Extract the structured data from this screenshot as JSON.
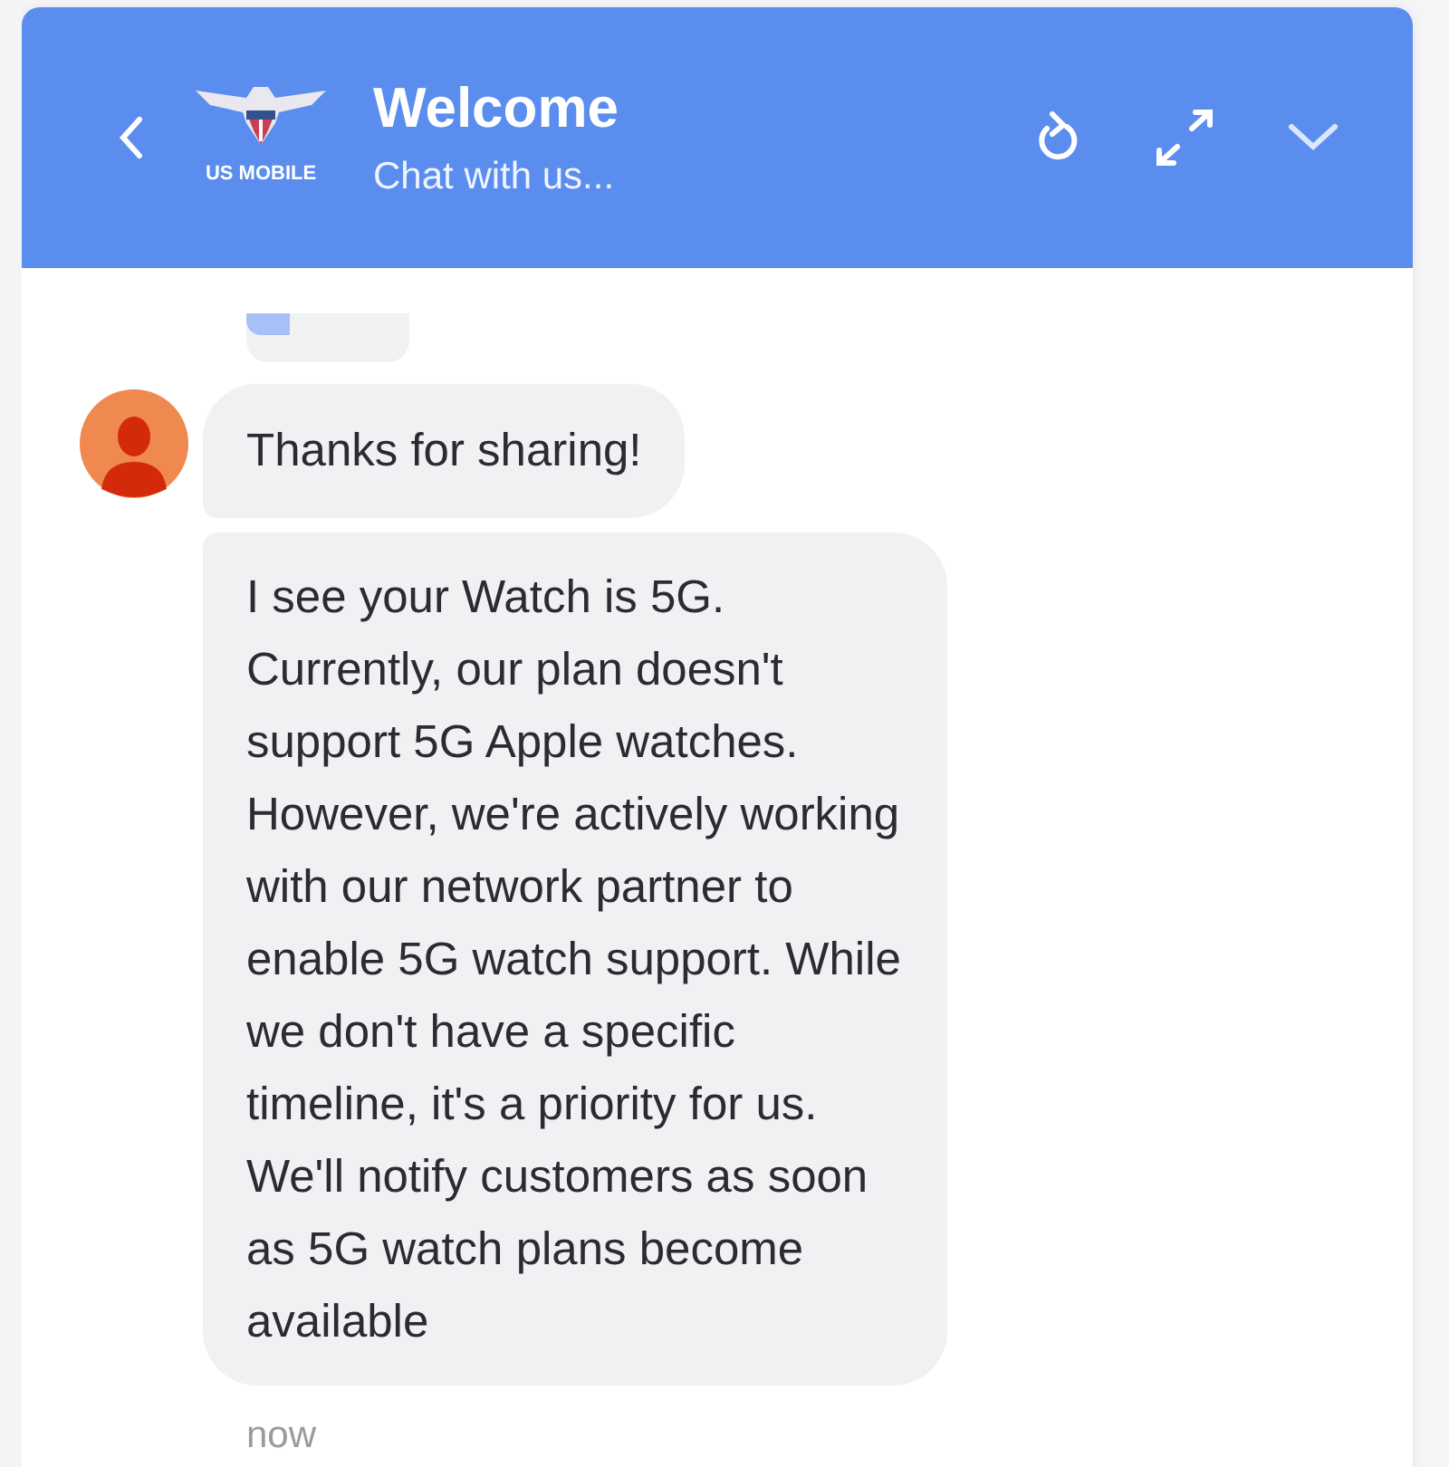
{
  "header": {
    "logo_text": "US MOBILE",
    "title": "Welcome",
    "subtitle": "Chat with us..."
  },
  "messages": [
    {
      "kind": "text",
      "lines": [
        "Thanks for sharing!"
      ]
    },
    {
      "kind": "text",
      "lines": [
        "I see your Watch is 5G.",
        "Currently, our plan doesn't",
        "support 5G Apple watches.",
        "However, we're actively working",
        "with our network partner to",
        "enable 5G watch support. While",
        "we don't have a specific",
        "timeline, it's a priority for us.",
        "We'll notify customers as soon",
        "as 5G watch plans become",
        "available"
      ]
    }
  ],
  "timestamp": "now"
}
